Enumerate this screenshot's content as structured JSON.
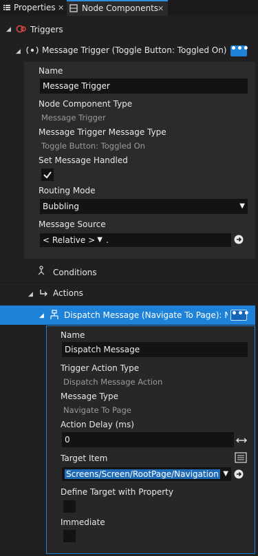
{
  "tabs": [
    {
      "label": "Properties",
      "close": "✕"
    },
    {
      "label": "Node Components",
      "close": "✕"
    }
  ],
  "tree": {
    "triggers_label": "Triggers",
    "message_trigger": {
      "header": "Message Trigger (Toggle Button: Toggled On)",
      "more": "•••",
      "name_label": "Name",
      "name_value": "Message Trigger",
      "component_type_label": "Node Component Type",
      "component_type_value": "Message Trigger",
      "message_type_label": "Message Trigger Message Type",
      "message_type_value": "Toggle Button: Toggled On",
      "handled_label": "Set Message Handled",
      "handled_checked": true,
      "routing_label": "Routing Mode",
      "routing_value": "Bubbling",
      "source_label": "Message Source",
      "source_mode": "< Relative >",
      "source_path": "."
    },
    "conditions_label": "Conditions",
    "actions_label": "Actions",
    "dispatch": {
      "header": "Dispatch Message (Navigate To Page): Naviga",
      "more": "•••",
      "name_label": "Name",
      "name_value": "Dispatch Message",
      "action_type_label": "Trigger Action Type",
      "action_type_value": "Dispatch Message Action",
      "message_type_label": "Message Type",
      "message_type_value": "Navigate To Page",
      "delay_label": "Action Delay (ms)",
      "delay_value": "0",
      "target_label": "Target Item",
      "target_value": "Screens/Screen/RootPage/Navigation",
      "define_target_label": "Define Target with Property",
      "define_target_checked": false,
      "immediate_label": "Immediate",
      "immediate_checked": false
    }
  },
  "colors": {
    "accent": "#1e82d8",
    "background": "#202020",
    "field": "#131313"
  }
}
